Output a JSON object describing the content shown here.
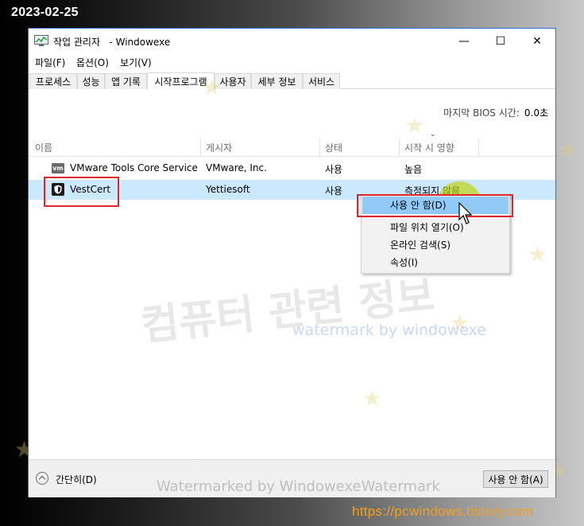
{
  "overlay": {
    "date": "2023-02-25",
    "site_url": "https://pcwindows.tistory.com",
    "watermark_korean": "컴퓨터 관련 정보",
    "watermark_english": "watermark by windowexe",
    "watermark_footer": "Watermarked by WindowexeWatermark"
  },
  "window": {
    "title": "작업 관리자   - Windowexe",
    "controls": {
      "minimize": "—",
      "maximize": "☐",
      "close": "✕"
    }
  },
  "menu": [
    "파일(F)",
    "옵션(O)",
    "보기(V)"
  ],
  "tabs": [
    {
      "label": "프로세스",
      "active": false
    },
    {
      "label": "성능",
      "active": false
    },
    {
      "label": "앱 기록",
      "active": false
    },
    {
      "label": "시작프로그램",
      "active": true
    },
    {
      "label": "사용자",
      "active": false
    },
    {
      "label": "세부 정보",
      "active": false
    },
    {
      "label": "서비스",
      "active": false
    }
  ],
  "bios": {
    "label": "마지막 BIOS 시간:",
    "value": "0.0초"
  },
  "columns": {
    "name": "이름",
    "publisher": "게시자",
    "status": "상태",
    "impact": "시작 시 영향",
    "sort_glyph": "⌄"
  },
  "rows": [
    {
      "icon": "vmware-icon",
      "icon_text": "vm",
      "name": "VMware Tools Core Service",
      "publisher": "VMware, Inc.",
      "status": "사용",
      "impact": "높음",
      "selected": false
    },
    {
      "icon": "shield-icon",
      "name": "VestCert",
      "publisher": "Yettiesoft",
      "status": "사용",
      "impact": "측정되지 않음",
      "selected": true
    }
  ],
  "context_menu": [
    {
      "label": "사용 안 함(D)",
      "highlighted": true
    },
    {
      "label": "파일 위치 열기(O)",
      "highlighted": false
    },
    {
      "label": "온라인 검색(S)",
      "highlighted": false
    },
    {
      "label": "속성(I)",
      "highlighted": false
    }
  ],
  "footer": {
    "fewer_details": "간단히(D)",
    "disable_button": "사용 안 함(A)"
  },
  "colors": {
    "accent_border": "#2b74c9",
    "selected_row": "#cce8ff",
    "menu_highlight": "#91c9f7",
    "annotation_red": "#e0242b",
    "url_orange": "#f0a020"
  }
}
